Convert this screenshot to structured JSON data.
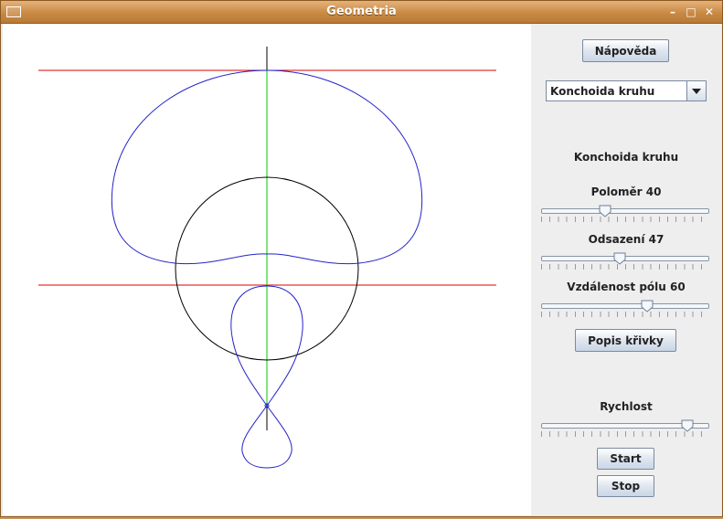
{
  "window": {
    "title": "Geometria"
  },
  "panel": {
    "help_button": "Nápověda",
    "curve_select": {
      "selected": "Konchoida kruhu"
    },
    "curve_title": "Konchoida kruhu",
    "sliders": [
      {
        "label": "Poloměr 40",
        "value_fraction": 0.38
      },
      {
        "label": "Odsazení 47",
        "value_fraction": 0.47
      },
      {
        "label": "Vzdálenost pólu 60",
        "value_fraction": 0.63
      }
    ],
    "describe_button": "Popis křivky",
    "speed": {
      "label": "Rychlost",
      "value_fraction": 0.87
    },
    "start_button": "Start",
    "stop_button": "Stop"
  },
  "colors": {
    "curve": "#2323c8",
    "circle": "#000000",
    "axis_vertical": "#00cc00",
    "tangent_lines": "#dd0000",
    "title_bar": "#c98a44"
  }
}
